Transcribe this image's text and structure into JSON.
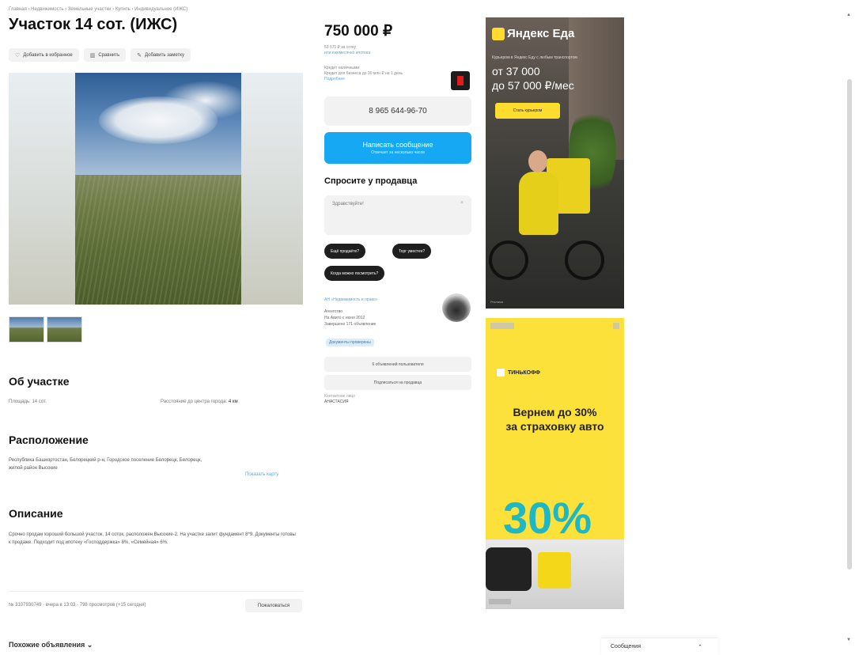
{
  "breadcrumb": "Главная › Недвижимость › Земельные участки › Купить › Индивидуальное (ИЖС)",
  "title": "Участок 14 сот. (ИЖС)",
  "actions": {
    "favorite": "Добавить в избранное",
    "compare": "Сравнить",
    "note": "Добавить заметку"
  },
  "about": {
    "heading": "Об участке",
    "area": "Площадь: 14 сот.",
    "distance_label": "Расстояние до центра города:",
    "distance_value": "4 км"
  },
  "location": {
    "heading": "Расположение",
    "address": "Республика Башкортостан, Белорецкий р-н, Городское поселение Белорецк, Белорецк, жилой район Высокие",
    "map_link": "Показать карту"
  },
  "description": {
    "heading": "Описание",
    "text": "Срочно продам хороший большой участок, 14 соток, расположен Высокие-2. На участке залит фундамент 8*9. Документы готовы к продаже. Подходит под ипотеку «Господдержка» 8%, «Семейная» 6%."
  },
  "footer_meta": "№ 3107930749 · вчера в 13:03 · 798 просмотров (+15 сегодня)",
  "complain_label": "Пожаловаться",
  "similar_label": "Похожие объявления ⌄",
  "price": {
    "value": "750 000 ₽",
    "per_unit": "53 571 ₽ за сотку",
    "mortgage_link": "или ежемесячно ипотека"
  },
  "credit": {
    "label": "Кредит наличными",
    "text": "Кредит для бизнеса до 30 млн ₽ на 1 день",
    "link": "Подробнее"
  },
  "phone": "8 965 644-96-70",
  "message_button": {
    "title": "Написать сообщение",
    "subtitle": "Отвечает за несколько часов"
  },
  "ask": {
    "heading": "Спросите у продавца",
    "placeholder": "Здравствуйте!",
    "chips": [
      "Ещё продаёте?",
      "Торг уместен?",
      "Когда можно посмотреть?"
    ]
  },
  "seller": {
    "name": "АН «Недвижимость и право»",
    "type": "Агентство",
    "since": "На Авито с июня 2012",
    "listings": "Завершено 171 объявление",
    "docs_badge": "Документы проверены"
  },
  "seller_buttons": {
    "other_listings": "6 объявлений пользователя",
    "subscribe": "Подписаться на продавца"
  },
  "contact_person": {
    "label": "Контактное лицо",
    "name": "АНАСТАСИЯ"
  },
  "ad_yandex": {
    "brand": "Яндекс Еда",
    "tagline": "Курьером в Яндекс Еду с любым транспортом",
    "earn_line1": "от 37 000",
    "earn_line2": "до 57 000 ₽/мес",
    "cta": "Стать курьером",
    "footer": "Реклама"
  },
  "ad_tinkoff": {
    "brand": "ТИНЬКОФФ",
    "headline1": "Вернем до 30%",
    "headline2": "за страховку авто",
    "big_number": "30%"
  },
  "scroll": {
    "up": "▲",
    "down": "▼"
  },
  "messages_bar": {
    "label": "Сообщения",
    "chevron": "⌃"
  },
  "colors": {
    "primary_blue": "#16a8f2",
    "link_blue": "#5aa7d8",
    "yandex_yellow": "#ffdc2e",
    "tinkoff_yellow": "#fbe13a",
    "teal_accent": "#20b7c5"
  }
}
